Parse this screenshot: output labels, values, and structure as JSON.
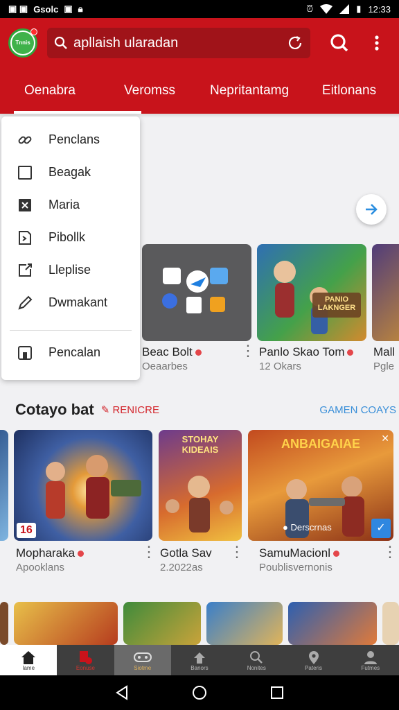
{
  "status_bar": {
    "left_text": "Gsolc",
    "time": "12:33"
  },
  "app_bar": {
    "logo_text": "Tnnis",
    "search_text": "apllaish ularadan"
  },
  "tabs": [
    {
      "label": "Oenabra",
      "active": true
    },
    {
      "label": "Veromss",
      "active": false
    },
    {
      "label": "Nepritantamg",
      "active": false
    },
    {
      "label": "Eitlonans",
      "active": false
    }
  ],
  "menu": {
    "items": [
      {
        "label": "Penclans",
        "icon": "link-icon"
      },
      {
        "label": "Beagak",
        "icon": "square-icon"
      },
      {
        "label": "Maria",
        "icon": "x-box-icon"
      },
      {
        "label": "Pibollk",
        "icon": "doc-icon"
      },
      {
        "label": "Lleplise",
        "icon": "share-icon"
      },
      {
        "label": "Dwmakant",
        "icon": "pen-icon"
      }
    ],
    "footer_item": {
      "label": "Pencalan",
      "icon": "archive-icon"
    }
  },
  "row1": [
    {
      "title": "Beac Bolt",
      "sub": "Oeaarbes"
    },
    {
      "title": "Panlo Skao Tom",
      "sub": "12 Okars",
      "thumb_text": "PANIO LAKNGER"
    },
    {
      "title": "Mall",
      "sub": "Pgle"
    }
  ],
  "section": {
    "title": "Cotayo bat",
    "tag": "RENICRE",
    "link": "GAMEN COAYS"
  },
  "row2": [
    {
      "title": "Mopharaka",
      "sub": "Apooklans",
      "badge": "16"
    },
    {
      "title": "Gotla Sav",
      "sub": "2.2022as",
      "thumb_text": "STOHAY KIDEAIS"
    },
    {
      "title": "SamuMacionl",
      "sub": "Poublisvernonis",
      "thumb_text": "ANBAIGAIAE",
      "overlay_text": "Derscrnas"
    }
  ],
  "bottom_nav": [
    {
      "label": "Iame",
      "icon": "home-icon"
    },
    {
      "label": "Eonuse",
      "icon": "bookmark-icon"
    },
    {
      "label": "Siotme",
      "icon": "games-icon"
    },
    {
      "label": "Banors",
      "icon": "apps-icon"
    },
    {
      "label": "Nonites",
      "icon": "search-icon"
    },
    {
      "label": "Pateris",
      "icon": "place-icon"
    },
    {
      "label": "Futmes",
      "icon": "person-icon"
    }
  ],
  "colors": {
    "primary": "#c8131b",
    "accent": "#3a8fd8",
    "nav_bg": "#3e3e3e"
  }
}
